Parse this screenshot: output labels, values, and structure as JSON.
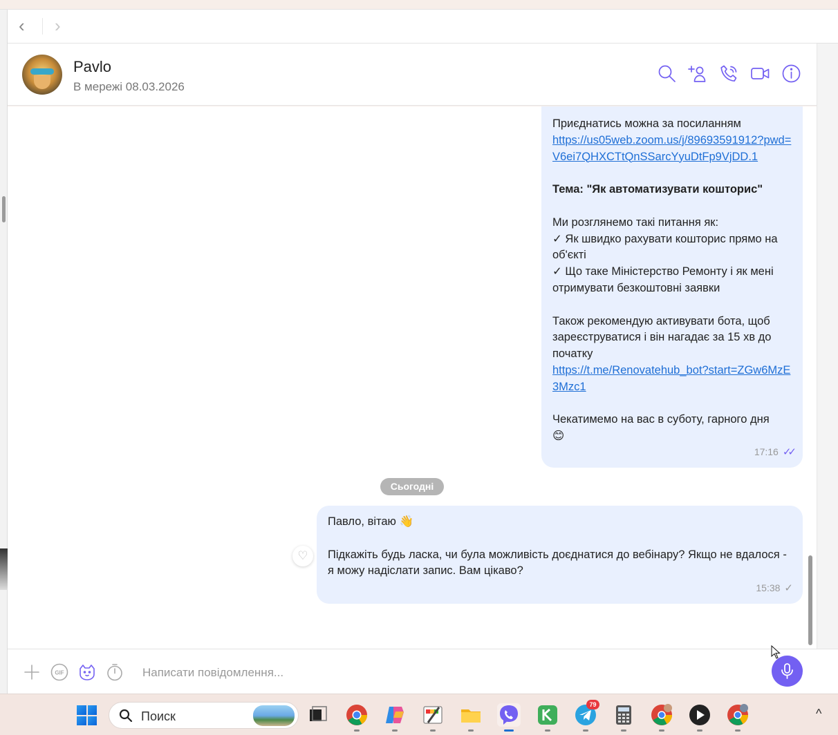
{
  "contact": {
    "name": "Pavlo",
    "status": "В мережі 08.03.2026"
  },
  "messages": [
    {
      "lines": [
        "Приєднатись можна за посиланням"
      ],
      "link1": "https://us05web.zoom.us/j/89693591912?pwd=V6ei7QHXCTtQnSSarcYyuDtFp9VjDD.1",
      "topic": "Тема: \"Як автоматизувати кошторис\"",
      "intro": "Ми розглянемо такі питання як:",
      "item1": "✓ Як швидко рахувати кошторис прямо на об'єкті",
      "item2": "✓ Що таке Міністерство Ремонту і як мені отримувати безкоштовні заявки",
      "bot_text": "Також рекомендую активувати бота, щоб зареєструватися і він нагадає за 15 хв до початку",
      "link2": "https://t.me/Renovatehub_bot?start=ZGw6MzE3Mzc1",
      "closing": "Чекатимемо на вас в суботу, гарного дня",
      "emoji": "😊",
      "time": "17:16"
    },
    {
      "greeting": "Павло, вітаю",
      "emoji": "👋",
      "body": "Підкажіть будь ласка, чи була можливість доєднатися до вебінару? Якщо не вдалося - я можу надіслати запис. Вам цікаво?",
      "time": "15:38"
    }
  ],
  "day_separator": "Сьогодні",
  "composer": {
    "placeholder": "Написати повідомлення..."
  },
  "taskbar": {
    "search_label": "Поиск",
    "telegram_badge": "79"
  },
  "icons": {
    "nav": [
      "back-arrow-icon",
      "forward-arrow-icon"
    ],
    "header": [
      "search-icon",
      "add-participant-icon",
      "call-icon",
      "video-call-icon",
      "info-icon"
    ],
    "composer": [
      "plus-icon",
      "gif-icon",
      "sticker-icon",
      "timer-icon",
      "microphone-icon"
    ]
  },
  "colors": {
    "accent": "#7360f2",
    "bubble": "#e9f0fe",
    "link": "#1f6fd6"
  }
}
